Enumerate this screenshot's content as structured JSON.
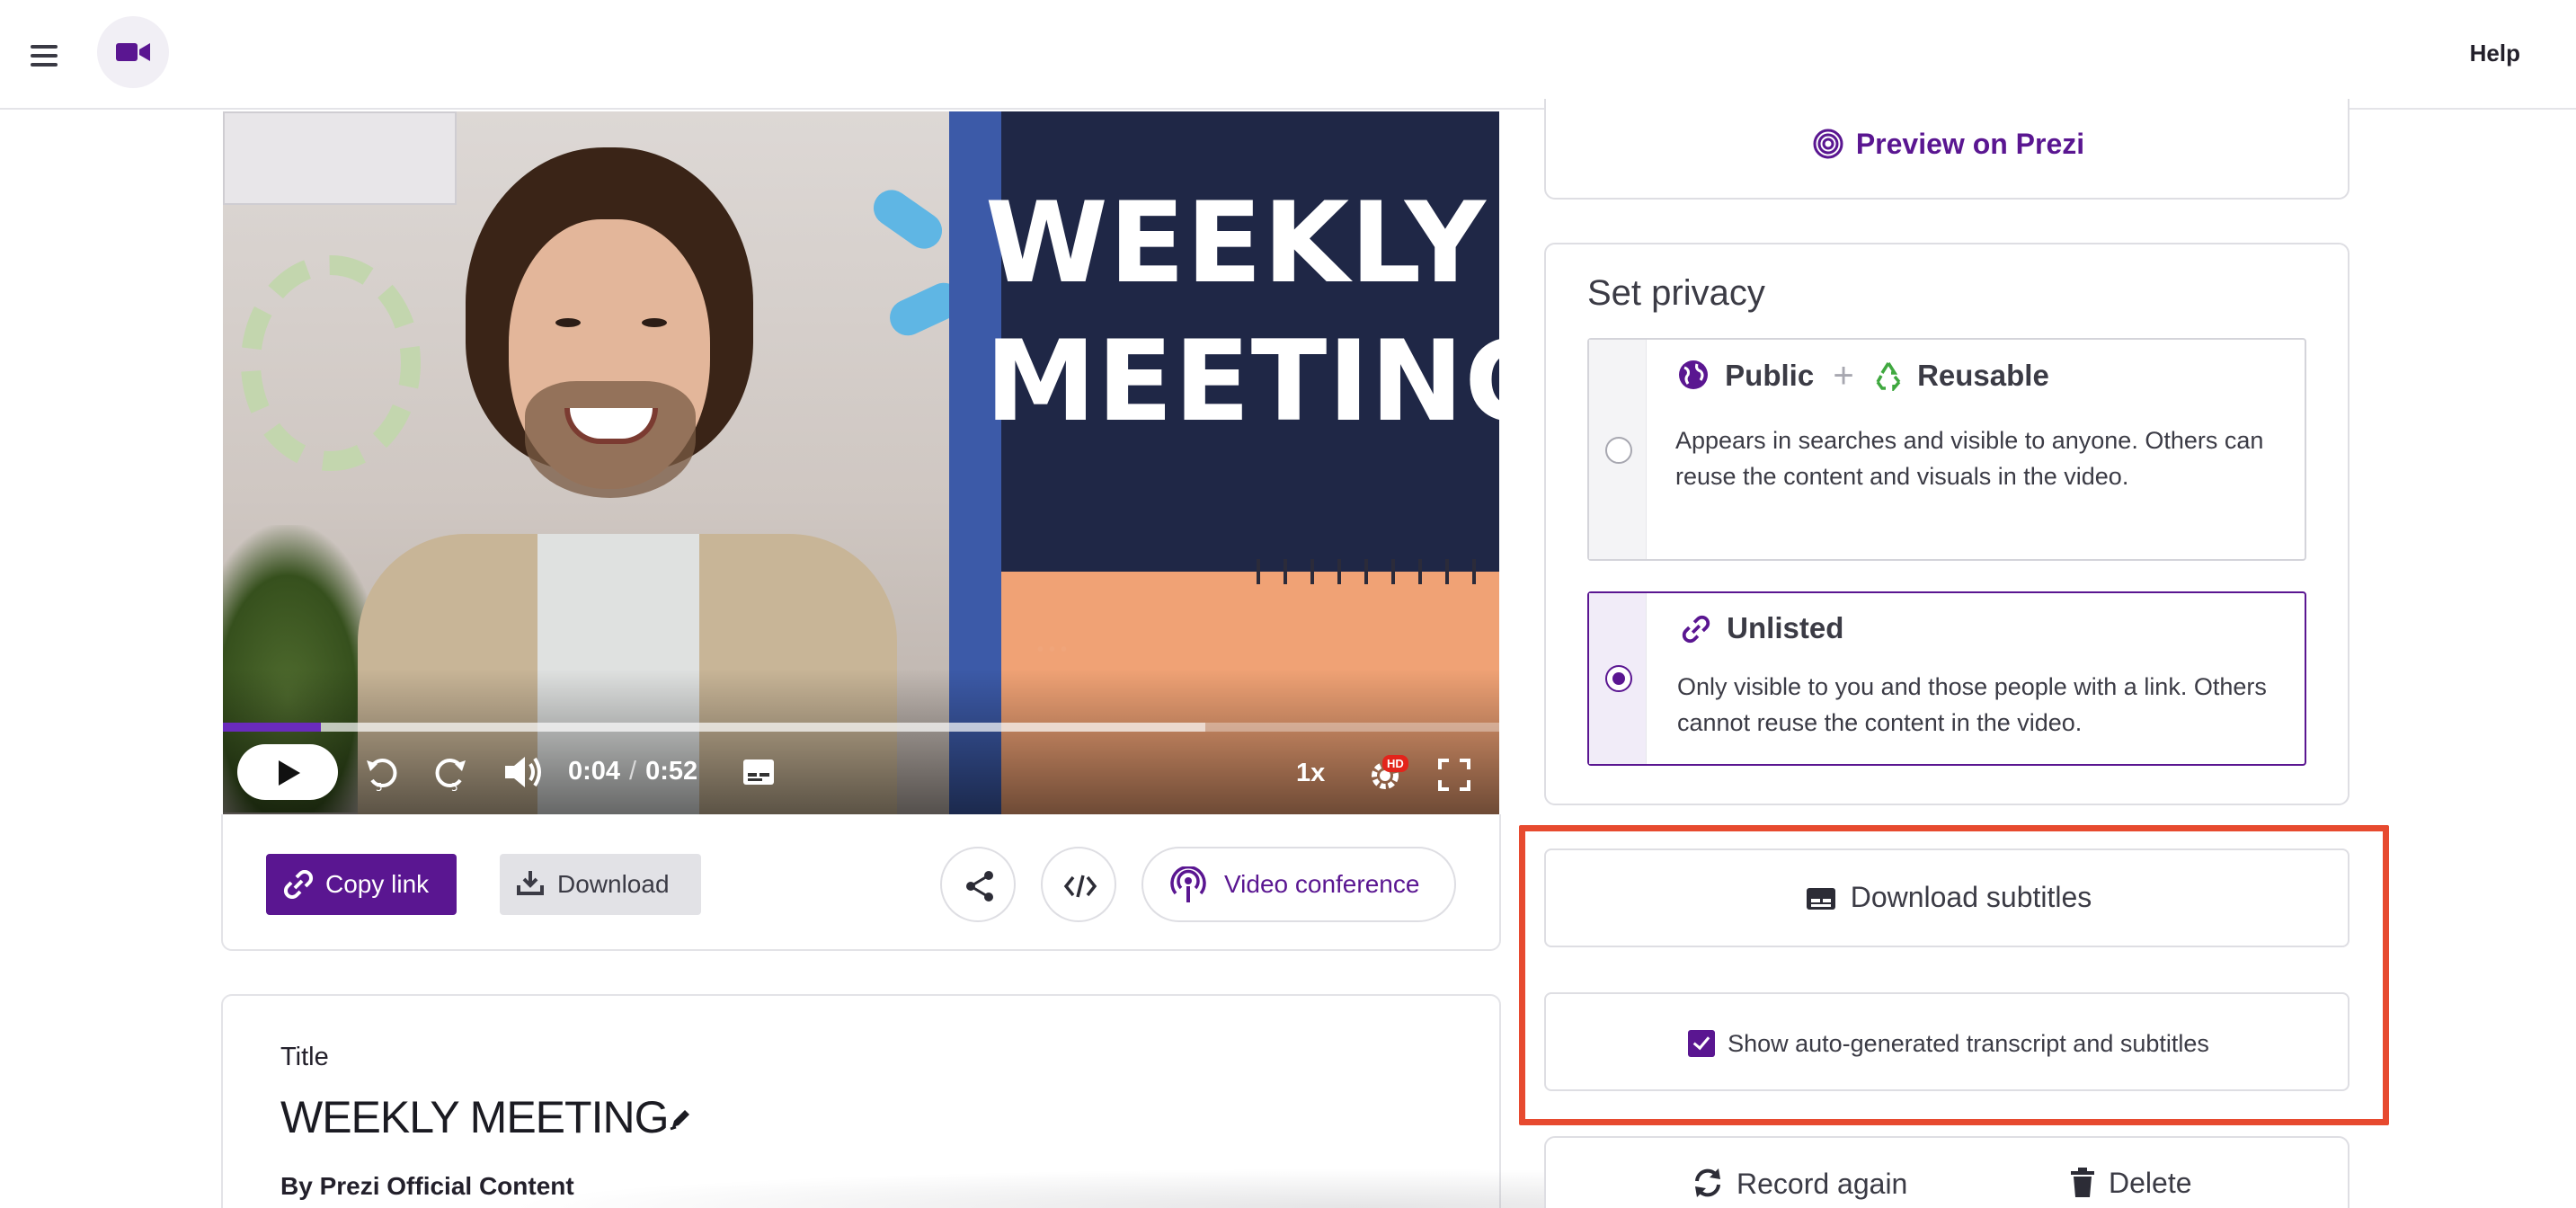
{
  "header": {
    "help_label": "Help",
    "app_icon": "video-camera-icon",
    "menu_icon": "hamburger-menu-icon"
  },
  "player": {
    "slide_title_line1": "WEEKLY",
    "slide_title_line2": "MEETING",
    "current_time": "0:04",
    "separator": "/",
    "duration": "0:52",
    "speed": "1x",
    "hd_badge": "HD",
    "progress": 0.077,
    "buffered": 0.77,
    "icons": [
      "play-icon",
      "rewind-5-icon",
      "forward-5-icon",
      "volume-icon",
      "captions-icon",
      "settings-icon",
      "fullscreen-icon"
    ]
  },
  "actions": {
    "copy_link_label": "Copy link",
    "download_label": "Download",
    "video_conference_label": "Video conference"
  },
  "details": {
    "title_label": "Title",
    "title_value": "WEEKLY MEETING",
    "byline": "By Prezi Official Content"
  },
  "sidebar": {
    "preview_label": "Preview on Prezi",
    "privacy_title": "Set privacy",
    "options": [
      {
        "label_a": "Public",
        "plus": "+",
        "label_b": "Reusable",
        "description": "Appears in searches and visible to anyone. Others can reuse the content and visuals in the video.",
        "selected": false
      },
      {
        "label_a": "Unlisted",
        "description": "Only visible to you and those people with a link. Others cannot reuse the content in the video.",
        "selected": true
      }
    ],
    "download_subtitles_label": "Download subtitles",
    "show_transcript_label": "Show auto-generated transcript and subtitles",
    "show_transcript_checked": true,
    "record_again_label": "Record again",
    "delete_label": "Delete"
  },
  "colors": {
    "brand_purple": "#5a1691",
    "highlight": "#e74a2f",
    "slide_navy": "#1f2746",
    "slide_orange": "#f0a275"
  }
}
